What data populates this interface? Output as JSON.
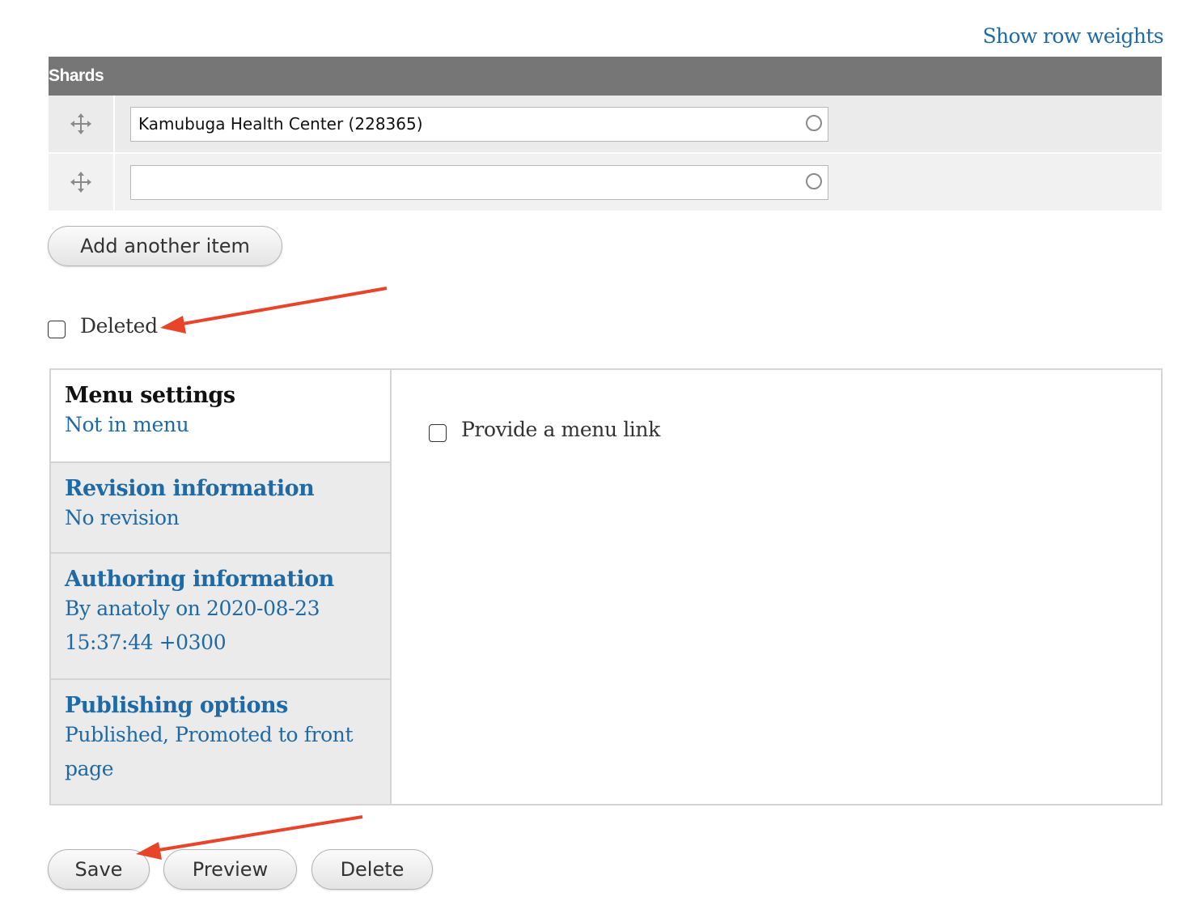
{
  "table": {
    "show_weights_label": "Show row weights",
    "header": "Shards",
    "rows": [
      {
        "value": "Kamubuga Health Center (228365)"
      },
      {
        "value": ""
      }
    ]
  },
  "add_another_label": "Add another item",
  "deleted_checkbox": {
    "label": "Deleted",
    "checked": false
  },
  "vertical_tabs": [
    {
      "title": "Menu settings",
      "summary": "Not in menu",
      "active": true
    },
    {
      "title": "Revision information",
      "summary": "No revision",
      "active": false
    },
    {
      "title": "Authoring information",
      "summary": "By anatoly on 2020-08-23 15:37:44 +0300",
      "active": false
    },
    {
      "title": "Publishing options",
      "summary": "Published, Promoted to front page",
      "active": false
    }
  ],
  "menu_settings_pane": {
    "provide_menu_link_label": "Provide a menu link",
    "checked": false
  },
  "actions": {
    "save_label": "Save",
    "preview_label": "Preview",
    "delete_label": "Delete"
  },
  "colors": {
    "link": "#1f6aa5",
    "table_header_bg": "#767676",
    "annotation_arrow": "#e8442a"
  },
  "icons": {
    "drag_handle": "move-arrows-icon",
    "autocomplete": "throbber-circle-icon"
  }
}
